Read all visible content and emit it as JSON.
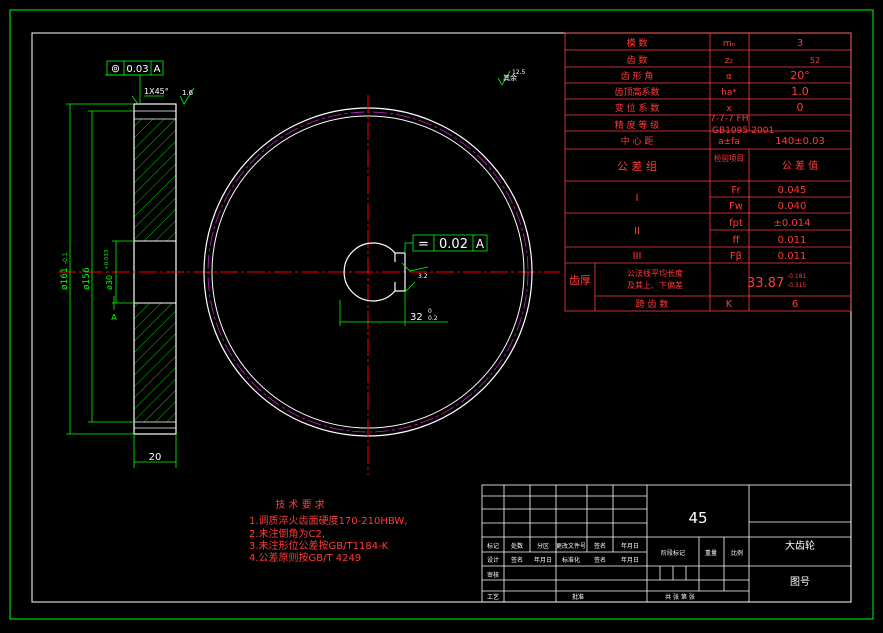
{
  "drawing": {
    "part_name": "大齿轮",
    "drawing_no_label": "图号",
    "material": "45",
    "colors": {
      "background": "#000000",
      "border": "#00ff00",
      "outline": "#ffffff",
      "center_line": "#ff0000",
      "table_text": "#ff3b3b",
      "hatch": "#00ff00",
      "pitch_circle": "#c020c0"
    }
  },
  "side_view": {
    "tolerance_frame": {
      "symbol": "⊚",
      "value": "0.03",
      "datum": "A"
    },
    "chamfer_note": "1X45°",
    "roughness_top": "1.6",
    "dims": {
      "outer": "ø161",
      "outer_tol": "-0.1",
      "root": "ø156",
      "bore": "ø30",
      "bore_tol": "+0.033",
      "width": "20"
    },
    "datum_label": "A"
  },
  "front_view": {
    "roughness_corner": "12.5",
    "roughness_corner_note": "其余",
    "key_tolerance": {
      "symbol": "=",
      "value": "0.02",
      "datum": "A"
    },
    "keyway_roughness": "3.2",
    "keyway_dim": "32",
    "keyway_dim_tol_upper": "0",
    "keyway_dim_tol_lower": "0.2"
  },
  "param_table": {
    "rows": [
      {
        "label": "模      数",
        "symbol": "mₙ",
        "value": "3"
      },
      {
        "label": "齿      数",
        "symbol": "z₂",
        "value": "52"
      },
      {
        "label": "齿 形 角",
        "symbol": "α",
        "value": "20°"
      },
      {
        "label": "齿顶高系数",
        "symbol": "ha*",
        "value": "1.0"
      },
      {
        "label": "变 位 系 数",
        "symbol": "x",
        "value": "0"
      },
      {
        "label": "精 度 等 级",
        "symbol": "7-7-7 FH",
        "value": "GB1095-2001"
      },
      {
        "label": "中  心  距",
        "symbol": "a±fa",
        "value": "140±0.03"
      }
    ],
    "group_label": "公   差   组",
    "check_item_label": "检验项目",
    "tol_value_label": "公 差 值",
    "groups": [
      {
        "name": "I",
        "items": [
          {
            "symbol": "Fr",
            "value": "0.045"
          },
          {
            "symbol": "Fw",
            "value": "0.040"
          }
        ]
      },
      {
        "name": "II",
        "items": [
          {
            "symbol": "fpt",
            "value": "±0.014"
          },
          {
            "symbol": "ff",
            "value": "0.011"
          }
        ]
      },
      {
        "name": "III",
        "items": [
          {
            "symbol": "Fβ",
            "value": "0.011"
          }
        ]
      }
    ],
    "thickness_label": "齿厚",
    "thickness_desc1": "公法线平均长度",
    "thickness_desc2": "及其上、下偏差",
    "thickness_value": "33.87",
    "thickness_tol_upper": "-0.181",
    "thickness_tol_lower": "-0.315",
    "span_label": "跨  齿  数",
    "span_symbol": "K",
    "span_value": "6"
  },
  "tech_req": {
    "title": "技  术  要  求",
    "items": [
      "1.调质淬火齿面硬度170-210HBW,",
      "2.未注倒角为C2,",
      "3.未注形位公差按GB/T1184-K",
      "4.公差原则按GB/T 4249"
    ]
  },
  "title_block": {
    "rev_headers": [
      "标记",
      "处数",
      "分区",
      "更改文件号",
      "签名",
      "年月日"
    ],
    "row2": [
      "设计",
      "签名",
      "年月日",
      "标准化",
      "签名",
      "年月日"
    ],
    "stage_labels": [
      "阶段标记",
      "重量",
      "比例"
    ],
    "review": "审核",
    "process": "工艺",
    "approve": "批准",
    "sheet_info": "共  张  第  张"
  }
}
